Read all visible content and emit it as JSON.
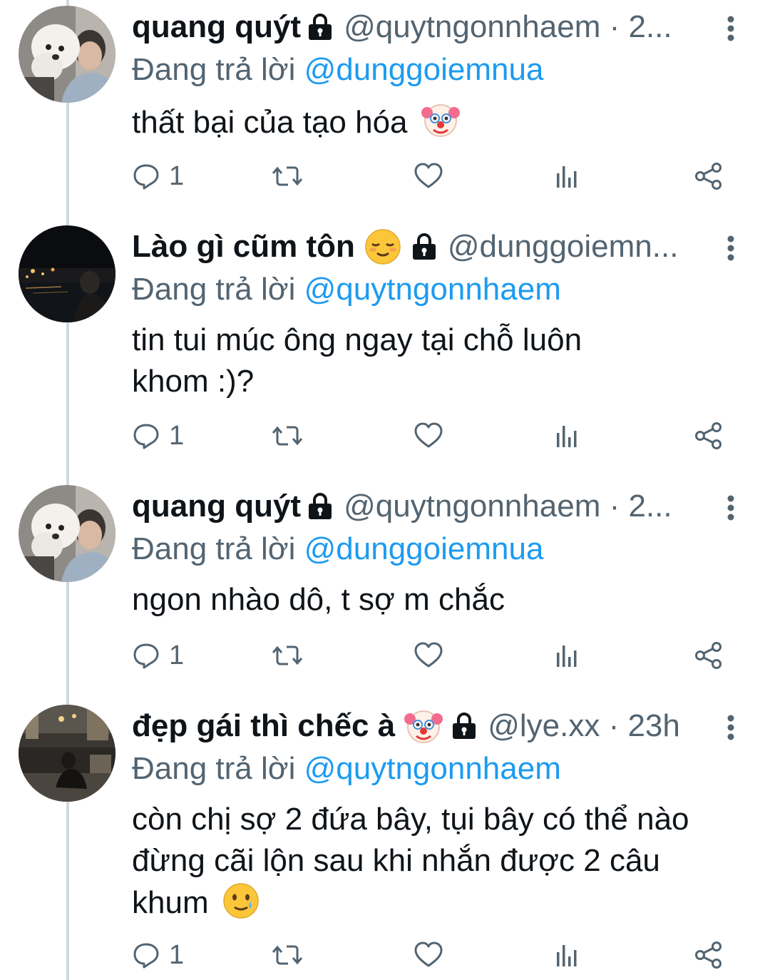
{
  "tweets": [
    {
      "name": "quang quýt",
      "handle_time": "@quytngonnhaem · 2...",
      "replying_prefix": "Đang trả lời ",
      "replying_to": "@dunggoiemnua",
      "text": "thất bại của tạo hóa",
      "text_emoji": "clown-face-emoji",
      "reply_count": "1",
      "avatar": "avatar-person-with-white-dog"
    },
    {
      "name": "Lào gì cũm tôn",
      "name_emoji": "relieved-face-emoji",
      "handle_time": "@dunggoiemn...",
      "replying_prefix": "Đang trả lời ",
      "replying_to": "@quytngonnhaem",
      "text": "tin tui múc ông ngay tại chỗ luôn khom :)?",
      "reply_count": "1",
      "avatar": "avatar-night-city-lake"
    },
    {
      "name": "quang quýt",
      "handle_time": "@quytngonnhaem · 2...",
      "replying_prefix": "Đang trả lời ",
      "replying_to": "@dunggoiemnua",
      "text": "ngon nhào dô, t sợ m chắc",
      "reply_count": "1",
      "avatar": "avatar-person-with-white-dog"
    },
    {
      "name": "đẹp gái thì chếc à",
      "name_emoji": "clown-face-emoji",
      "handle_time": "@lye.xx · 23h",
      "replying_prefix": "Đang trả lời ",
      "replying_to": "@quytngonnhaem",
      "text": "còn chị sợ 2 đứa bây, tụi bây có thể nào đừng cãi lộn sau khi nhắn được 2 câu khum",
      "text_emoji": "smiling-face-with-tear-emoji",
      "reply_count": "1",
      "avatar": "avatar-poolside-night"
    }
  ],
  "icons": {
    "lock": "lock-icon",
    "more": "more-vertical-icon",
    "reply": "reply-icon",
    "retweet": "retweet-icon",
    "like": "heart-icon",
    "stats": "stats-icon",
    "share": "share-icon"
  },
  "colors": {
    "text": "#0f1419",
    "secondary": "#536471",
    "mention": "#1d9bf0",
    "thread_line": "#cfd9de"
  }
}
